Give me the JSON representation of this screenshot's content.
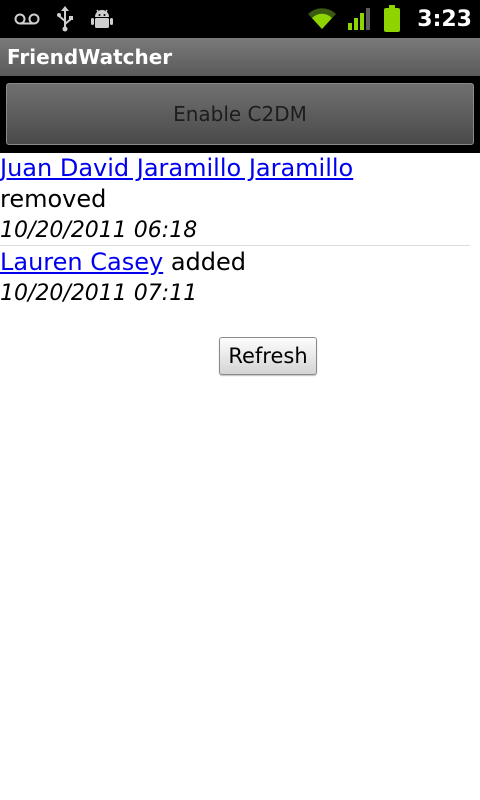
{
  "status_bar": {
    "time": "3:23",
    "icons_left": [
      "voicemail-icon",
      "usb-icon",
      "android-debug-icon"
    ],
    "icons_right": [
      "wifi-icon",
      "signal-icon",
      "battery-icon"
    ]
  },
  "app": {
    "title": "FriendWatcher"
  },
  "c2dm_button": {
    "label": "Enable C2DM"
  },
  "entries": [
    {
      "name": "Juan David Jaramillo Jaramillo",
      "action": "removed",
      "timestamp": "10/20/2011 06:18"
    },
    {
      "name": "Lauren Casey",
      "action": "added",
      "timestamp": "10/20/2011 07:11"
    }
  ],
  "refresh_button": {
    "label": "Refresh"
  },
  "colors": {
    "link": "#0000ee",
    "status_bar_bg": "#000000",
    "title_bar_bg": "#6a6a6a",
    "accent_green": "#8fd400"
  }
}
